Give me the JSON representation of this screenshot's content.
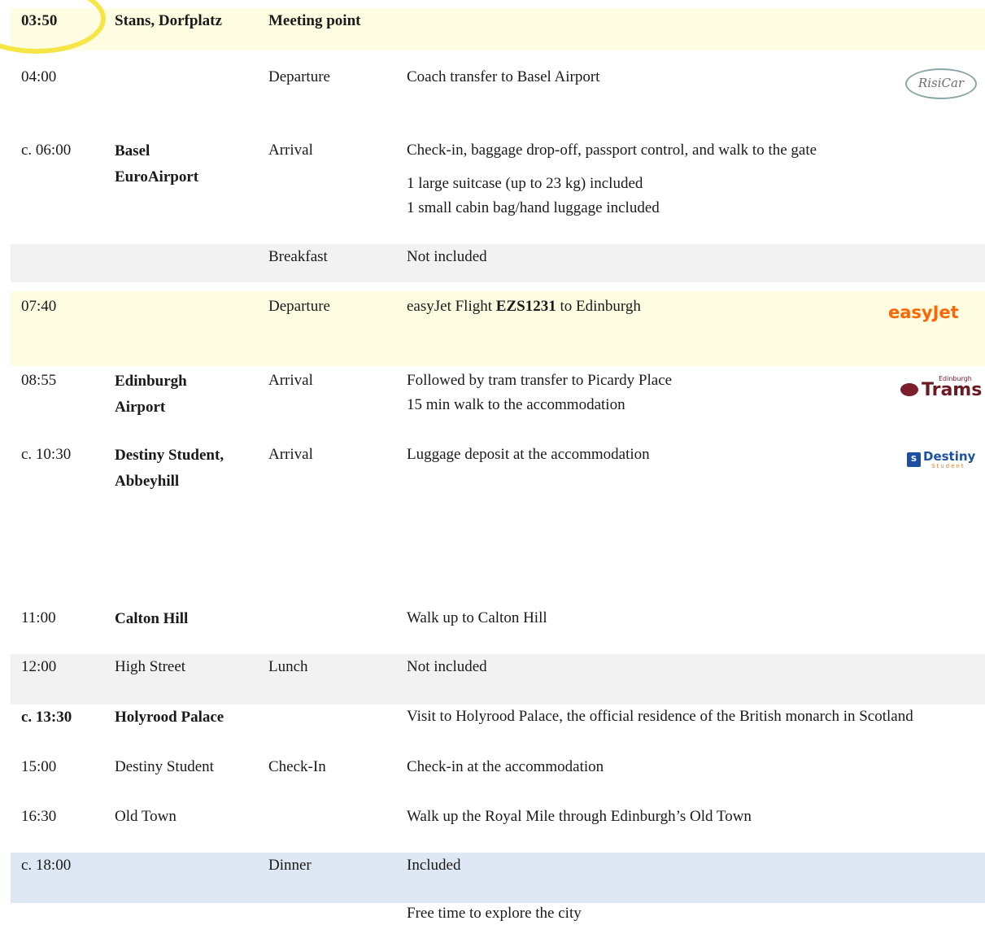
{
  "rows": [
    {
      "time": "03:50",
      "place": "Stans, Dorfplatz",
      "type": "Meeting point",
      "desc": []
    },
    {
      "time": "04:00",
      "place": "",
      "type": "Departure",
      "desc": [
        "Coach transfer to Basel Airport"
      ],
      "logo": "RisiCar"
    },
    {
      "time": "c. 06:00",
      "place": [
        "Basel",
        "EuroAirport"
      ],
      "type": "Arrival",
      "desc": [
        "Check-in, baggage drop-off, passport control, and walk to the gate",
        "1 large suitcase (up to 23 kg) included",
        "1 small cabin bag/hand luggage included"
      ]
    },
    {
      "time": "",
      "place": "",
      "type": "Breakfast",
      "desc": [
        "Not included"
      ]
    },
    {
      "time": "07:40",
      "place": "",
      "type": "Departure",
      "desc": {
        "pre": "easyJet Flight ",
        "flight": "EZS1231",
        "post": " to Edinburgh"
      },
      "logo": "easyJet"
    },
    {
      "time": "08:55",
      "place": [
        "Edinburgh",
        "Airport"
      ],
      "type": "Arrival",
      "desc": [
        "Followed by tram transfer to Picardy Place",
        "15 min walk to the accommodation"
      ],
      "logo": {
        "small": "Edinburgh",
        "big": "Trams"
      }
    },
    {
      "time": "c. 10:30",
      "place": [
        "Destiny Student,",
        "Abbeyhill"
      ],
      "type": "Arrival",
      "desc": [
        "Luggage deposit at the accommodation"
      ],
      "logo": {
        "name": "Destiny",
        "sub": "Student"
      }
    },
    {
      "time": "11:00",
      "place": "Calton Hill",
      "type": "",
      "desc": [
        "Walk up to Calton Hill"
      ]
    },
    {
      "time": "12:00",
      "place": "High Street",
      "type": "Lunch",
      "desc": [
        "Not included"
      ]
    },
    {
      "time": "c. 13:30",
      "place": "Holyrood Palace",
      "type": "",
      "desc": [
        "Visit to Holyrood Palace, the official residence of the British monarch in Scotland"
      ]
    },
    {
      "time": "15:00",
      "place": "Destiny Student",
      "type": "Check-In",
      "desc": [
        "Check-in at the accommodation"
      ]
    },
    {
      "time": "16:30",
      "place": "Old Town",
      "type": "",
      "desc": [
        "Walk up the Royal Mile through Edinburgh’s Old Town"
      ]
    },
    {
      "time": "c. 18:00",
      "place": "",
      "type": "Dinner",
      "desc": [
        "Included"
      ]
    },
    {
      "time": "",
      "place": "",
      "type": "",
      "desc": [
        "Free time to explore the city"
      ]
    }
  ],
  "colors": {
    "highlight_yellow": "#fffde1",
    "grey": "#f2f2f2",
    "blue": "#dee8f4",
    "easyjet_orange": "#ff6600",
    "ring": "#f5e646"
  }
}
